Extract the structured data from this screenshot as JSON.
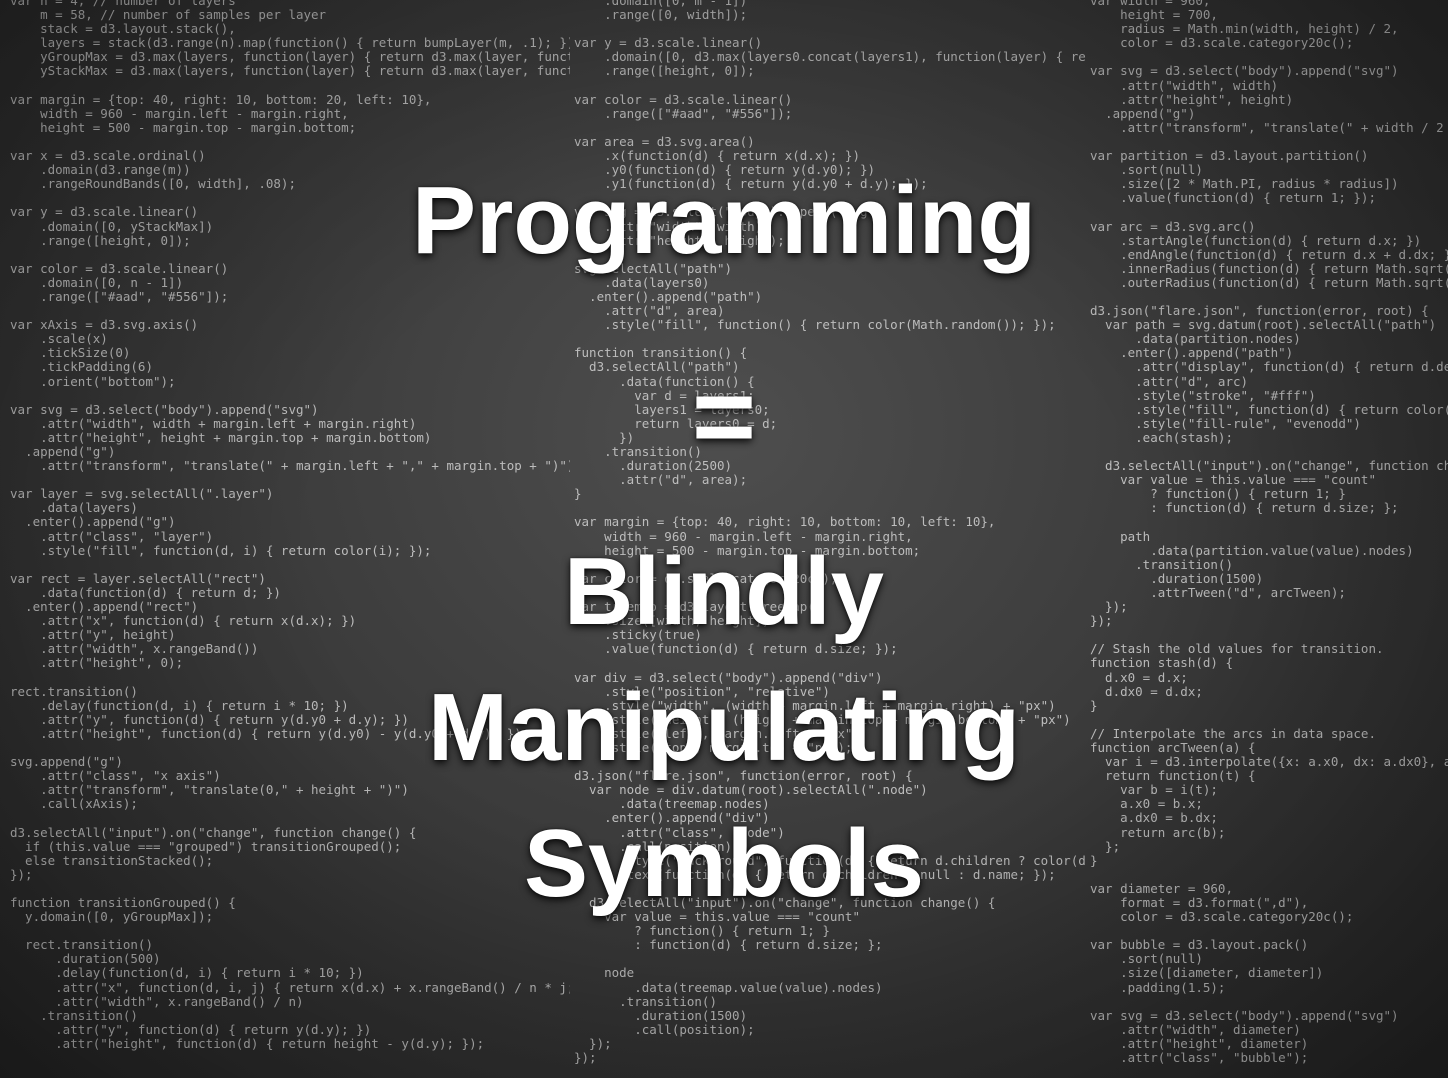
{
  "slide": {
    "title_line1": "Programming",
    "equals": "=",
    "title_line2": "Blindly",
    "title_line3": "Manipulating",
    "title_line4": "Symbols"
  },
  "code": {
    "column1": "var n = 4, // number of layers\n    m = 58, // number of samples per layer\n    stack = d3.layout.stack(),\n    layers = stack(d3.range(n).map(function() { return bumpLayer(m, .1); })),\n    yGroupMax = d3.max(layers, function(layer) { return d3.max(layer, function(\n    yStackMax = d3.max(layers, function(layer) { return d3.max(layer, function(\n\nvar margin = {top: 40, right: 10, bottom: 20, left: 10},\n    width = 960 - margin.left - margin.right,\n    height = 500 - margin.top - margin.bottom;\n\nvar x = d3.scale.ordinal()\n    .domain(d3.range(m))\n    .rangeRoundBands([0, width], .08);\n\nvar y = d3.scale.linear()\n    .domain([0, yStackMax])\n    .range([height, 0]);\n\nvar color = d3.scale.linear()\n    .domain([0, n - 1])\n    .range([\"#aad\", \"#556\"]);\n\nvar xAxis = d3.svg.axis()\n    .scale(x)\n    .tickSize(0)\n    .tickPadding(6)\n    .orient(\"bottom\");\n\nvar svg = d3.select(\"body\").append(\"svg\")\n    .attr(\"width\", width + margin.left + margin.right)\n    .attr(\"height\", height + margin.top + margin.bottom)\n  .append(\"g\")\n    .attr(\"transform\", \"translate(\" + margin.left + \",\" + margin.top + \")\");\n\nvar layer = svg.selectAll(\".layer\")\n    .data(layers)\n  .enter().append(\"g\")\n    .attr(\"class\", \"layer\")\n    .style(\"fill\", function(d, i) { return color(i); });\n\nvar rect = layer.selectAll(\"rect\")\n    .data(function(d) { return d; })\n  .enter().append(\"rect\")\n    .attr(\"x\", function(d) { return x(d.x); })\n    .attr(\"y\", height)\n    .attr(\"width\", x.rangeBand())\n    .attr(\"height\", 0);\n\nrect.transition()\n    .delay(function(d, i) { return i * 10; })\n    .attr(\"y\", function(d) { return y(d.y0 + d.y); })\n    .attr(\"height\", function(d) { return y(d.y0) - y(d.y0 + d.y); });\n\nsvg.append(\"g\")\n    .attr(\"class\", \"x axis\")\n    .attr(\"transform\", \"translate(0,\" + height + \")\")\n    .call(xAxis);\n\nd3.selectAll(\"input\").on(\"change\", function change() {\n  if (this.value === \"grouped\") transitionGrouped();\n  else transitionStacked();\n});\n\nfunction transitionGrouped() {\n  y.domain([0, yGroupMax]);\n\n  rect.transition()\n      .duration(500)\n      .delay(function(d, i) { return i * 10; })\n      .attr(\"x\", function(d, i, j) { return x(d.x) + x.rangeBand() / n * j; })\n      .attr(\"width\", x.rangeBand() / n)\n    .transition()\n      .attr(\"y\", function(d) { return y(d.y); })\n      .attr(\"height\", function(d) { return height - y(d.y); });",
    "column2": "    .domain([0, m - 1])\n    .range([0, width]);\n\nvar y = d3.scale.linear()\n    .domain([0, d3.max(layers0.concat(layers1), function(layer) { return\n    .range([height, 0]);\n\nvar color = d3.scale.linear()\n    .range([\"#aad\", \"#556\"]);\n\nvar area = d3.svg.area()\n    .x(function(d) { return x(d.x); })\n    .y0(function(d) { return y(d.y0); })\n    .y1(function(d) { return y(d.y0 + d.y); });\n\nvar svg = d3.select(\"body\").append(\"svg\")\n    .attr(\"width\", width)\n    .attr(\"height\", height);\n\nsvg.selectAll(\"path\")\n    .data(layers0)\n  .enter().append(\"path\")\n    .attr(\"d\", area)\n    .style(\"fill\", function() { return color(Math.random()); });\n\nfunction transition() {\n  d3.selectAll(\"path\")\n      .data(function() {\n        var d = layers1;\n        layers1 = layers0;\n        return layers0 = d;\n      })\n    .transition()\n      .duration(2500)\n      .attr(\"d\", area);\n}\n\nvar margin = {top: 40, right: 10, bottom: 10, left: 10},\n    width = 960 - margin.left - margin.right,\n    height = 500 - margin.top - margin.bottom;\n\nvar color = d3.scale.category20c();\n\nvar treemap = d3.layout.treemap()\n    .size([width, height])\n    .sticky(true)\n    .value(function(d) { return d.size; });\n\nvar div = d3.select(\"body\").append(\"div\")\n    .style(\"position\", \"relative\")\n    .style(\"width\", (width + margin.left + margin.right) + \"px\")\n    .style(\"height\", (height + margin.top + margin.bottom) + \"px\")\n    .style(\"left\", margin.left + \"px\")\n    .style(\"top\", margin.top + \"px\");\n\nd3.json(\"flare.json\", function(error, root) {\n  var node = div.datum(root).selectAll(\".node\")\n      .data(treemap.nodes)\n    .enter().append(\"div\")\n      .attr(\"class\", \"node\")\n      .call(position)\n      .style(\"background\", function(d) { return d.children ? color(d.name\n      .text(function(d) { return d.children ? null : d.name; });\n\n  d3.selectAll(\"input\").on(\"change\", function change() {\n    var value = this.value === \"count\"\n        ? function() { return 1; }\n        : function(d) { return d.size; };\n\n    node\n        .data(treemap.value(value).nodes)\n      .transition()\n        .duration(1500)\n        .call(position);\n  });\n});",
    "column3": "var width = 960,\n    height = 700,\n    radius = Math.min(width, height) / 2,\n    color = d3.scale.category20c();\n\nvar svg = d3.select(\"body\").append(\"svg\")\n    .attr(\"width\", width)\n    .attr(\"height\", height)\n  .append(\"g\")\n    .attr(\"transform\", \"translate(\" + width / 2 + \",\n\nvar partition = d3.layout.partition()\n    .sort(null)\n    .size([2 * Math.PI, radius * radius])\n    .value(function(d) { return 1; });\n\nvar arc = d3.svg.arc()\n    .startAngle(function(d) { return d.x; })\n    .endAngle(function(d) { return d.x + d.dx; })\n    .innerRadius(function(d) { return Math.sqrt(d.\n    .outerRadius(function(d) { return Math.sqrt(d.\n\nd3.json(\"flare.json\", function(error, root) {\n  var path = svg.datum(root).selectAll(\"path\")\n      .data(partition.nodes)\n    .enter().append(\"path\")\n      .attr(\"display\", function(d) { return d.depth\n      .attr(\"d\", arc)\n      .style(\"stroke\", \"#fff\")\n      .style(\"fill\", function(d) { return color((d\n      .style(\"fill-rule\", \"evenodd\")\n      .each(stash);\n\n  d3.selectAll(\"input\").on(\"change\", function chan\n    var value = this.value === \"count\"\n        ? function() { return 1; }\n        : function(d) { return d.size; };\n\n    path\n        .data(partition.value(value).nodes)\n      .transition()\n        .duration(1500)\n        .attrTween(\"d\", arcTween);\n  });\n});\n\n// Stash the old values for transition.\nfunction stash(d) {\n  d.x0 = d.x;\n  d.dx0 = d.dx;\n}\n\n// Interpolate the arcs in data space.\nfunction arcTween(a) {\n  var i = d3.interpolate({x: a.x0, dx: a.dx0}, a);\n  return function(t) {\n    var b = i(t);\n    a.x0 = b.x;\n    a.dx0 = b.dx;\n    return arc(b);\n  };\n}\n\nvar diameter = 960,\n    format = d3.format(\",d\"),\n    color = d3.scale.category20c();\n\nvar bubble = d3.layout.pack()\n    .sort(null)\n    .size([diameter, diameter])\n    .padding(1.5);\n\nvar svg = d3.select(\"body\").append(\"svg\")\n    .attr(\"width\", diameter)\n    .attr(\"height\", diameter)\n    .attr(\"class\", \"bubble\");"
  }
}
